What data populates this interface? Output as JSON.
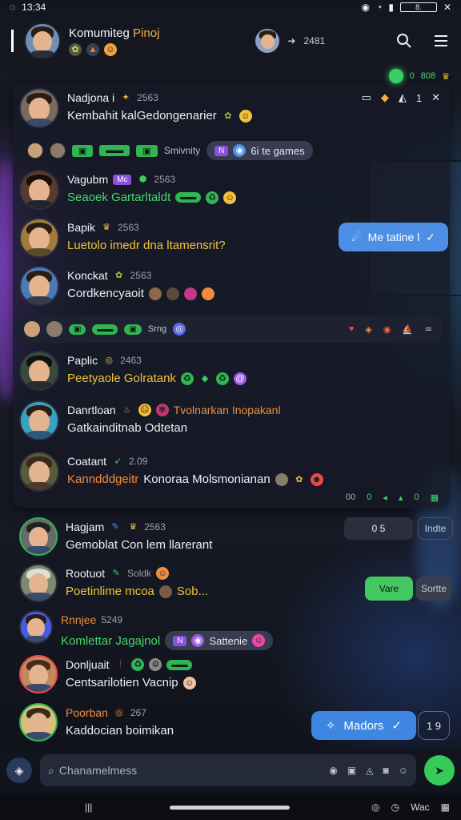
{
  "status_bar": {
    "time": "13:34",
    "battery": "8."
  },
  "header": {
    "title_main": "Komumiteg ",
    "title_highlight": "Pinoj",
    "member_count": "2481"
  },
  "online_row": {
    "a": "0",
    "b": "808"
  },
  "panel": {
    "tool_count": "1"
  },
  "messages": [
    {
      "name": "Nadjona i",
      "meta": "2563",
      "text": "Kembahit kalGedongenarier"
    },
    {
      "name": "Vagubm",
      "meta": "2563",
      "text": "Seaoek Gartarltaldt"
    },
    {
      "name": "Bapik",
      "meta": "2563",
      "text": "Luetolo imedr dna ltamensrit?"
    },
    {
      "name": "Konckat",
      "meta": "2563",
      "text": "Cordkencyaoit"
    },
    {
      "name": "Paplic",
      "meta": "2463",
      "text": "Peetyaole Golratank"
    },
    {
      "name": "Danrtloan",
      "meta": "",
      "text": "Tvolnarkan Inopakanl",
      "text2": "Gatkainditnab Odtetan"
    },
    {
      "name": "Coatant",
      "meta": "2.09",
      "text": "Kanndddgeitr",
      "text2": "Konoraa Molsmonianan"
    },
    {
      "name": "Hagjam",
      "meta": "2563",
      "text": "Gemoblat Con lem llarerant"
    },
    {
      "name": "Rootuot",
      "meta": "Soldk",
      "text": "Poetinlime mcoa",
      "text2": "Sob..."
    },
    {
      "name": "Rnnjee",
      "meta": "5249",
      "text": "Komlettar Jagajnol"
    },
    {
      "name": "Donljuait",
      "meta": "",
      "text": "Centsarilotien Vacnip"
    },
    {
      "name": "Poorban",
      "meta": "267",
      "text": "Kaddocian boimikan"
    }
  ],
  "strips": {
    "s1": {
      "label": "Smivnity",
      "pill": "6i te games"
    },
    "s2": {
      "label": "Srng"
    }
  },
  "tag_bubble": "Me tatine l",
  "pill_sattenie": "Sattenie",
  "panel_foot": [
    "00",
    "0",
    "0"
  ],
  "side": {
    "b1": "0 5",
    "b2": "Indte",
    "b3": "Vare",
    "b4": "Sortte"
  },
  "mador": {
    "label": "Madors",
    "num": "1 9"
  },
  "composer": {
    "placeholder": "Chanamelmess"
  },
  "navbar": {
    "b": "Wac"
  }
}
